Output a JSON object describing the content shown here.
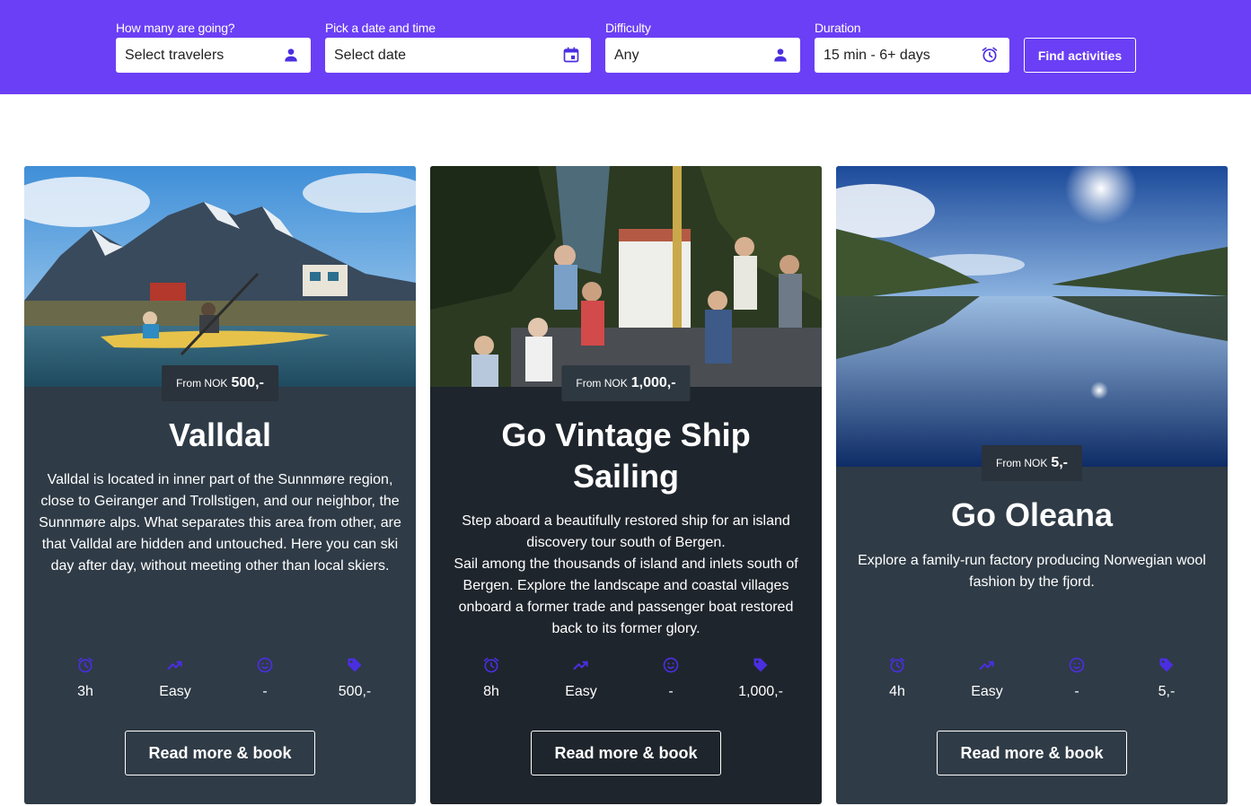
{
  "search": {
    "travelers": {
      "label": "How many are going?",
      "placeholder": "Select travelers",
      "icon": "person-icon"
    },
    "date": {
      "label": "Pick a date and time",
      "placeholder": "Select date",
      "icon": "calendar-icon"
    },
    "difficulty": {
      "label": "Difficulty",
      "value": "Any",
      "icon": "person-icon"
    },
    "duration": {
      "label": "Duration",
      "value": "15 min - 6+ days",
      "icon": "alarm-clock-icon"
    },
    "find_label": "Find activities"
  },
  "colors": {
    "brand": "#6b3ff5",
    "icon_accent": "#4a2fe0",
    "card_bg": "#2f3b46",
    "card_bg_alt": "#1f252c"
  },
  "cards": [
    {
      "price_from": "From NOK",
      "price": "500,-",
      "title": "Valldal",
      "description": "Valldal is located in inner part of the Sunnmøre region, close to Geiranger and Trollstigen, and our neighbor, the Sunnmøre alps. What separates this area from other, are that Valldal are hidden and untouched. Here you can ski day after day, without meeting other than local skiers.",
      "stats": {
        "duration": "3h",
        "difficulty": "Easy",
        "age": "-",
        "price": "500,-"
      },
      "button": "Read more & book",
      "image": "kayakers-mountain-photo"
    },
    {
      "price_from": "From NOK",
      "price": "1,000,-",
      "title": "Go Vintage Ship Sailing",
      "description": "Step aboard a beautifully restored ship for an island discovery tour south of Bergen.\nSail among the thousands of island and inlets south of Bergen. Explore the landscape and coastal villages onboard a former trade and passenger boat restored back to its former glory.",
      "stats": {
        "duration": "8h",
        "difficulty": "Easy",
        "age": "-",
        "price": "1,000,-"
      },
      "button": "Read more & book",
      "image": "vintage-ship-deck-photo"
    },
    {
      "price_from": "From NOK",
      "price": "5,-",
      "title": "Go Oleana",
      "description": "Explore a family-run factory producing Norwegian wool fashion by the fjord.",
      "stats": {
        "duration": "4h",
        "difficulty": "Easy",
        "age": "-",
        "price": "5,-"
      },
      "button": "Read more & book",
      "image": "fjord-lake-photo"
    }
  ]
}
